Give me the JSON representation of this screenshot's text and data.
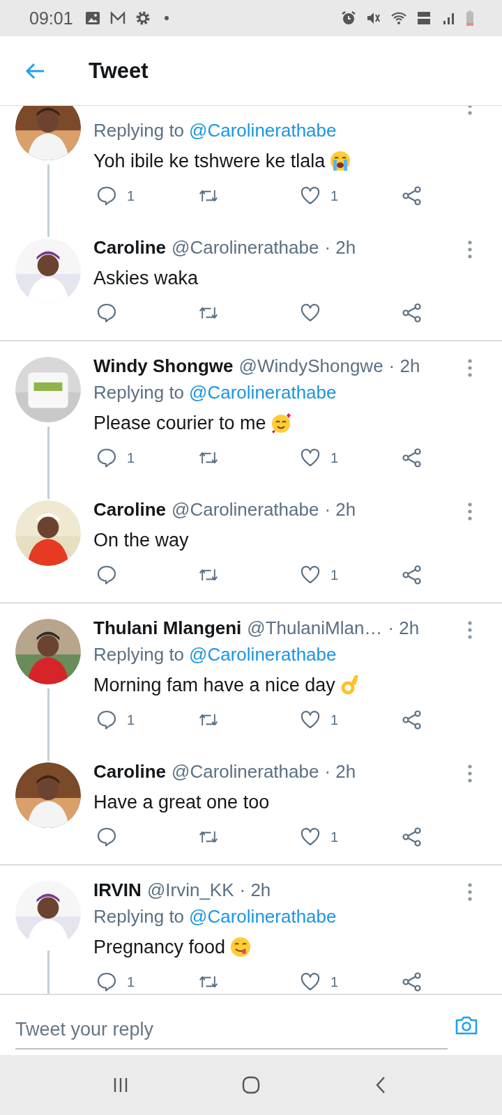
{
  "status_bar": {
    "time": "09:01"
  },
  "header": {
    "title": "Tweet"
  },
  "threads": [
    {
      "tweets": [
        {
          "replying_prefix": "Replying to",
          "replying_to": "@Carolinerathabe",
          "text": "Yoh ibile ke tshwere ke tlala",
          "emoji": {
            "kind": "crying"
          },
          "reply_count": "1",
          "like_count": "1",
          "thread_line": true
        },
        {
          "name": "Caroline",
          "handle": "@Carolinerathabe",
          "time": "· 2h",
          "text": "Askies waka",
          "thread_line": false
        }
      ]
    },
    {
      "tweets": [
        {
          "name": "Windy Shongwe",
          "handle": "@WindyShongwe",
          "time": "· 2h",
          "replying_prefix": "Replying to",
          "replying_to": "@Carolinerathabe",
          "text": "Please courier to me",
          "emoji": {
            "kind": "hearts"
          },
          "reply_count": "1",
          "like_count": "1",
          "thread_line": true
        },
        {
          "name": "Caroline",
          "handle": "@Carolinerathabe",
          "time": "· 2h",
          "text": "On the way",
          "like_count": "1",
          "thread_line": false
        }
      ]
    },
    {
      "tweets": [
        {
          "name": "Thulani Mlangeni",
          "handle": "@ThulaniMlan…",
          "time": "· 2h",
          "replying_prefix": "Replying to",
          "replying_to": "@Carolinerathabe",
          "text": "Morning fam have a nice day",
          "emoji": {
            "kind": "ok_hand"
          },
          "reply_count": "1",
          "like_count": "1",
          "thread_line": true
        },
        {
          "name": "Caroline",
          "handle": "@Carolinerathabe",
          "time": "· 2h",
          "text": "Have a great one too",
          "like_count": "1",
          "thread_line": false
        }
      ]
    },
    {
      "tweets": [
        {
          "name": "IRVIN",
          "handle": "@Irvin_KK",
          "time": "· 2h",
          "replying_prefix": "Replying to",
          "replying_to": "@Carolinerathabe",
          "text": "Pregnancy food",
          "emoji": {
            "kind": "yum"
          },
          "reply_count": "1",
          "like_count": "1",
          "thread_line": true
        }
      ]
    }
  ],
  "compose": {
    "placeholder": "Tweet your reply"
  }
}
